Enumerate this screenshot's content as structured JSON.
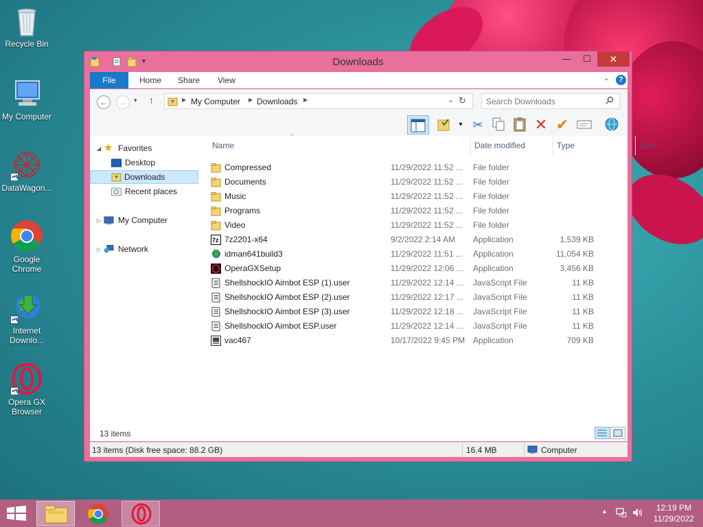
{
  "desktop": {
    "icons": [
      {
        "label": "Recycle Bin"
      },
      {
        "label": "My Computer"
      },
      {
        "label": "DataWagon..."
      },
      {
        "label": "Google Chrome"
      },
      {
        "label": "Internet Downlo..."
      },
      {
        "label": "Opera GX Browser"
      }
    ]
  },
  "window": {
    "title": "Downloads",
    "controls": {
      "minimize": "—",
      "maximize": "☐",
      "close": "✕"
    },
    "ribbon": {
      "tabs": [
        "File",
        "Home",
        "Share",
        "View"
      ],
      "collapse_icon": "chevron-down-icon",
      "help_icon": "help-icon"
    },
    "address": {
      "crumbs": [
        "My Computer",
        "Downloads"
      ],
      "search_placeholder": "Search Downloads"
    },
    "nav": {
      "favorites": "Favorites",
      "desktop": "Desktop",
      "downloads": "Downloads",
      "recent": "Recent places",
      "computer": "My Computer",
      "network": "Network"
    },
    "columns": {
      "name": "Name",
      "date": "Date modified",
      "type": "Type",
      "size": "Size"
    },
    "files": [
      {
        "name": "Compressed",
        "date": "11/29/2022 11:52 ...",
        "type": "File folder",
        "size": "",
        "icon": "folder"
      },
      {
        "name": "Documents",
        "date": "11/29/2022 11:52 ...",
        "type": "File folder",
        "size": "",
        "icon": "folder"
      },
      {
        "name": "Music",
        "date": "11/29/2022 11:52 ...",
        "type": "File folder",
        "size": "",
        "icon": "folder"
      },
      {
        "name": "Programs",
        "date": "11/29/2022 11:52 ...",
        "type": "File folder",
        "size": "",
        "icon": "folder"
      },
      {
        "name": "Video",
        "date": "11/29/2022 11:52 ...",
        "type": "File folder",
        "size": "",
        "icon": "folder"
      },
      {
        "name": "7z2201-x64",
        "date": "9/2/2022 2:14 AM",
        "type": "Application",
        "size": "1,539 KB",
        "icon": "7zip"
      },
      {
        "name": "idman641build3",
        "date": "11/29/2022 11:51 ...",
        "type": "Application",
        "size": "11,054 KB",
        "icon": "idm"
      },
      {
        "name": "OperaGXSetup",
        "date": "11/29/2022 12:06 ...",
        "type": "Application",
        "size": "3,456 KB",
        "icon": "opera"
      },
      {
        "name": "ShellshockIO Aimbot  ESP (1).user",
        "date": "11/29/2022 12:14 ...",
        "type": "JavaScript File",
        "size": "11 KB",
        "icon": "script"
      },
      {
        "name": "ShellshockIO Aimbot  ESP (2).user",
        "date": "11/29/2022 12:17 ...",
        "type": "JavaScript File",
        "size": "11 KB",
        "icon": "script"
      },
      {
        "name": "ShellshockIO Aimbot  ESP (3).user",
        "date": "11/29/2022 12:18 ...",
        "type": "JavaScript File",
        "size": "11 KB",
        "icon": "script"
      },
      {
        "name": "ShellshockIO Aimbot  ESP.user",
        "date": "11/29/2022 12:14 ...",
        "type": "JavaScript File",
        "size": "11 KB",
        "icon": "script"
      },
      {
        "name": "vac467",
        "date": "10/17/2022 9:45 PM",
        "type": "Application",
        "size": "709 KB",
        "icon": "app"
      }
    ],
    "item_count": "13 items",
    "status": {
      "left": "13 items (Disk free space: 88.2 GB)",
      "size": "16.4 MB",
      "location": "Computer"
    }
  },
  "taskbar": {
    "time": "12:19 PM",
    "date": "11/29/2022"
  },
  "colors": {
    "window_frame": "#e96f9d",
    "close_button": "#c7393b",
    "file_tab": "#1979ca",
    "taskbar": "#b25e80"
  }
}
